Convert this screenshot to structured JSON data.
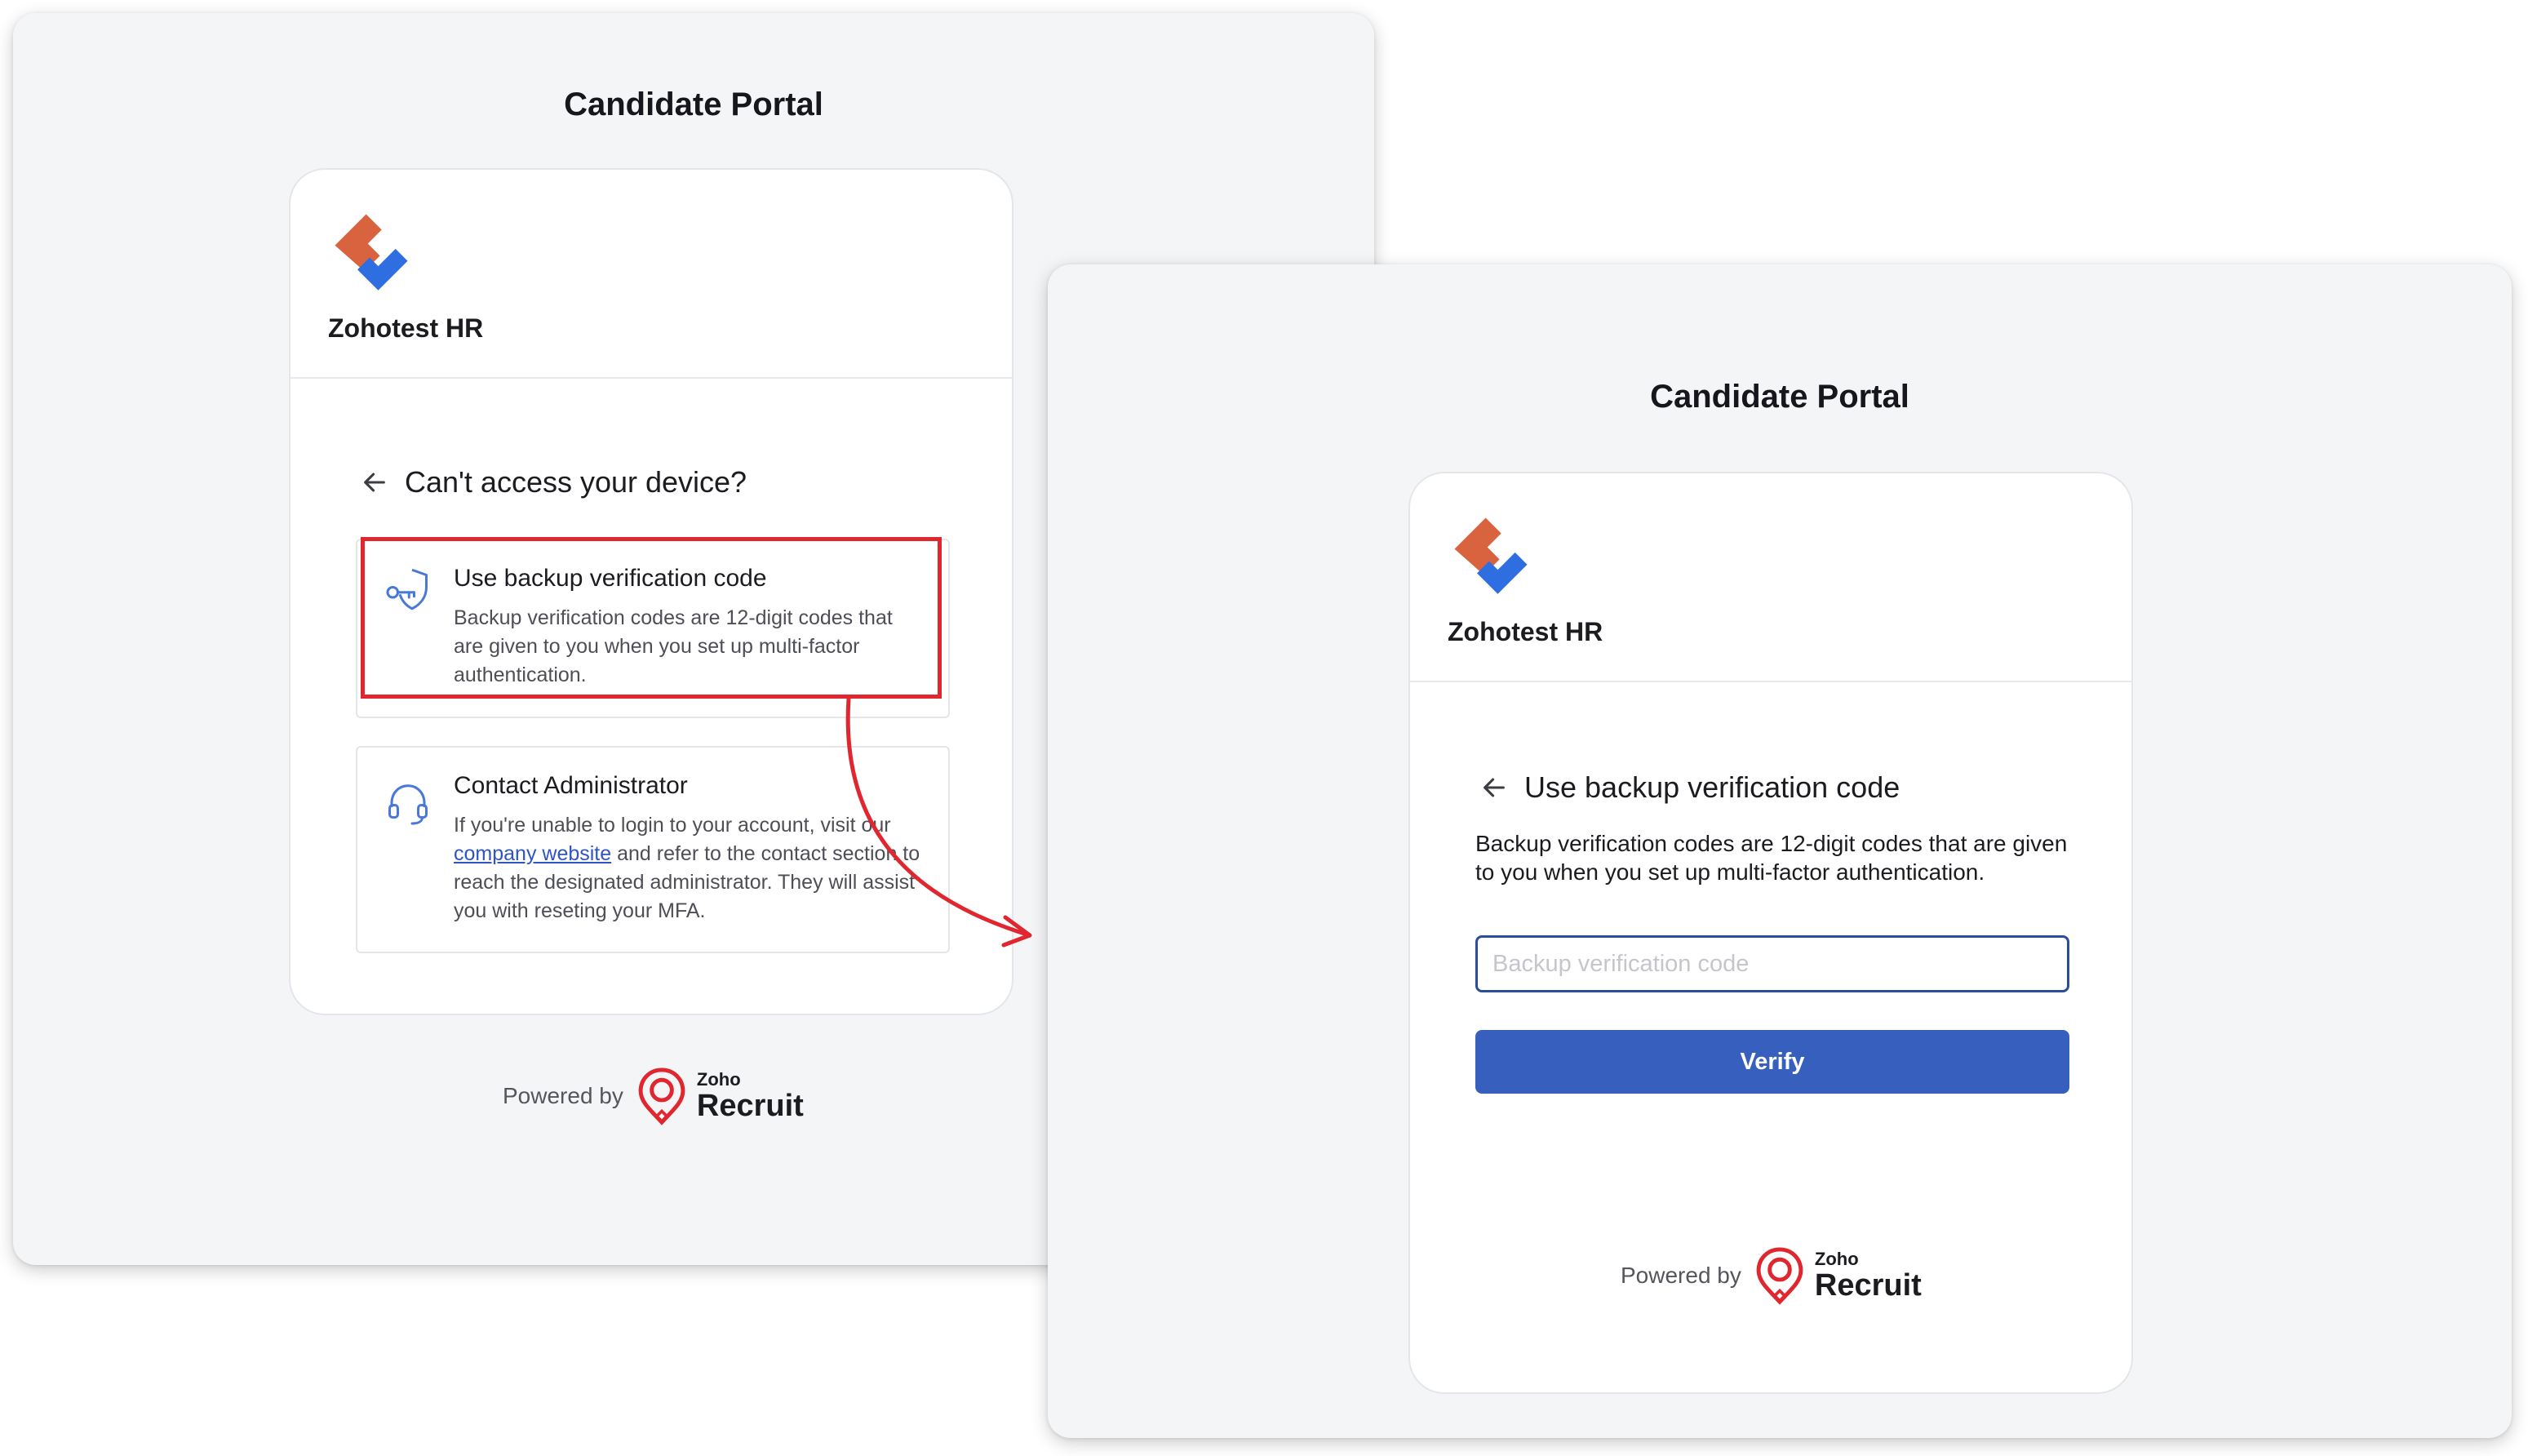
{
  "left_screen": {
    "portal_title": "Candidate Portal",
    "org_name": "Zohotest HR",
    "back_title": "Can't access your device?",
    "options": [
      {
        "title": "Use backup verification code",
        "description": "Backup verification codes are 12-digit codes that are given to you when you set up multi-factor authentication."
      },
      {
        "title": "Contact Administrator",
        "desc_before_link": "If you're unable to login to your account, visit our ",
        "link_text": "company website",
        "desc_after_link": " and refer to the contact section to reach the designated administrator. They will assist you with reseting your MFA."
      }
    ],
    "powered_by": "Powered by",
    "brand_top": "Zoho",
    "brand_name": "Recruit"
  },
  "right_screen": {
    "portal_title": "Candidate Portal",
    "org_name": "Zohotest HR",
    "back_title": "Use backup verification code",
    "description": "Backup verification codes are 12-digit codes that are given to you when you set up multi-factor authentication.",
    "input_placeholder": "Backup verification code",
    "input_value": "",
    "verify_label": "Verify",
    "powered_by": "Powered by",
    "brand_top": "Zoho",
    "brand_name": "Recruit"
  },
  "colors": {
    "highlight": "#e0262f",
    "primary_button": "#365fbe",
    "link": "#2f55c4",
    "icon_blue": "#4a78d8",
    "logo_orange": "#d9623f",
    "logo_blue": "#2f6ee0",
    "panel_bg": "#f4f5f7"
  },
  "icons": {
    "back": "arrow-left-icon",
    "backup_code": "shield-key-icon",
    "admin": "headset-icon",
    "org_logo": "zohotest-logo",
    "recruit_logo": "zoho-recruit-logo"
  }
}
